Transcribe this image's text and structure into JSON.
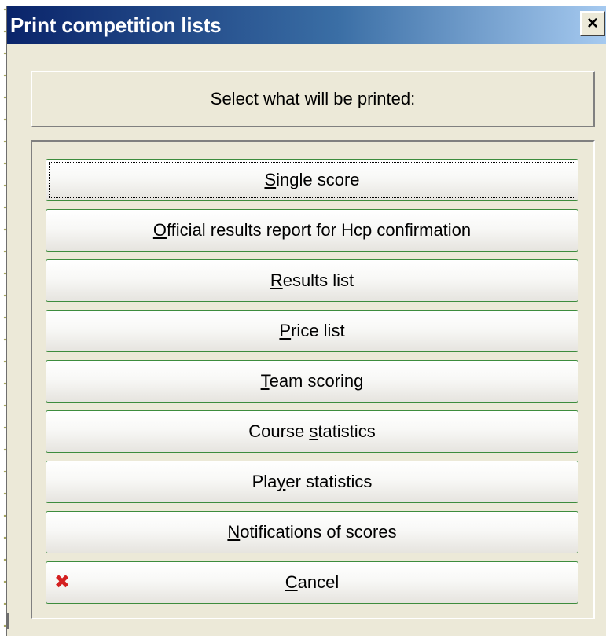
{
  "window": {
    "title": "Print competition lists",
    "close_glyph": "×"
  },
  "header": {
    "prompt": "Select what will be printed:"
  },
  "buttons": [
    {
      "pre": "",
      "key": "S",
      "post": "ingle score"
    },
    {
      "pre": "",
      "key": "O",
      "post": "fficial results report for Hcp confirmation"
    },
    {
      "pre": "",
      "key": "R",
      "post": "esults list"
    },
    {
      "pre": "",
      "key": "P",
      "post": "rice list"
    },
    {
      "pre": "",
      "key": "T",
      "post": "eam scoring"
    },
    {
      "pre": "Course ",
      "key": "s",
      "post": "tatistics"
    },
    {
      "pre": "Pla",
      "key": "y",
      "post": "er statistics"
    },
    {
      "pre": "",
      "key": "N",
      "post": "otifications of scores"
    },
    {
      "pre": "",
      "key": "C",
      "post": "ancel",
      "icon": "red-x-icon"
    }
  ],
  "colors": {
    "title_bar_start": "#0a246a",
    "title_bar_end": "#a6caf0",
    "button_border": "#3d8c3d",
    "cancel_icon": "#d42020"
  }
}
